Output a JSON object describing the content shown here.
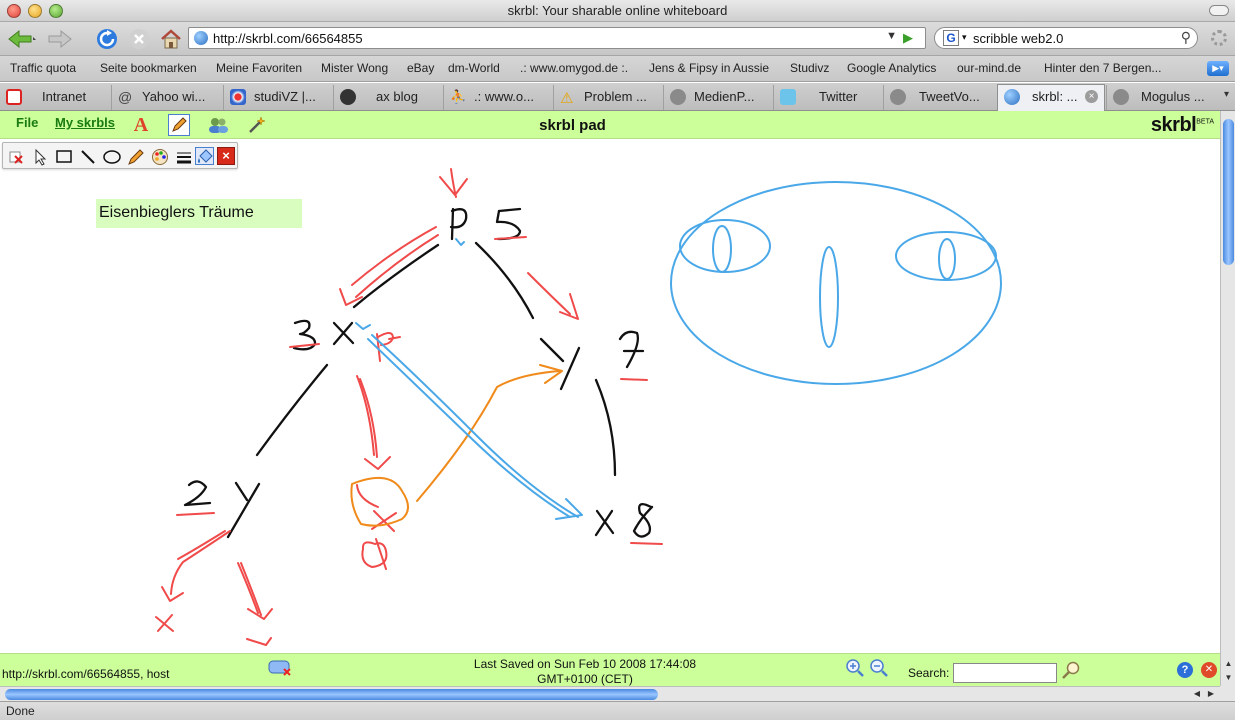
{
  "window": {
    "title": "skrbl: Your sharable online whiteboard"
  },
  "nav": {
    "url": "http://skrbl.com/66564855",
    "search_value": "scribble web2.0"
  },
  "bookmarks": [
    "Traffic quota",
    "Seite bookmarken",
    "Meine Favoriten",
    "Mister Wong",
    "eBay",
    "dm-World",
    ".: www.omygod.de :.",
    "Jens & Fipsy in Aussie",
    "Studivz",
    "Google Analytics",
    "our-mind.de",
    "Hinter den 7 Bergen..."
  ],
  "tabs": [
    {
      "label": "Intranet",
      "icon": "pdf-icon"
    },
    {
      "label": "Yahoo wi...",
      "icon": "at-icon"
    },
    {
      "label": "studiVZ |...",
      "icon": "studivz-icon"
    },
    {
      "label": "ax blog",
      "icon": "wordpress-icon"
    },
    {
      "label": ".: www.o...",
      "icon": "figure-icon"
    },
    {
      "label": "Problem ...",
      "icon": "warning-icon"
    },
    {
      "label": "MedienP...",
      "icon": "generic-page-icon"
    },
    {
      "label": "Twitter",
      "icon": "twitter-icon"
    },
    {
      "label": "TweetVo...",
      "icon": "generic-page-icon"
    },
    {
      "label": "skrbl: ...",
      "icon": "globe-icon",
      "active": true
    },
    {
      "label": "Mogulus ...",
      "icon": "generic-page-icon"
    }
  ],
  "app": {
    "file_label": "File",
    "my_skrbls_label": "My skrbls",
    "pad_title": "skrbl pad",
    "brand": "skrbl",
    "brand_tag": "BETA",
    "note_text": "Eisenbieglers Träume"
  },
  "drawtools": [
    "clear-icon",
    "select-arrow-icon",
    "rectangle-icon",
    "line-icon",
    "ellipse-icon",
    "pencil-icon",
    "palette-icon",
    "line-width-icon",
    "fill-bucket-icon",
    "close-icon"
  ],
  "status": {
    "pad_url": "http://skrbl.com/66564855, host",
    "saved_line1": "Last Saved on Sun Feb 10 2008 17:44:08",
    "saved_line2": "GMT+0100 (CET)",
    "search_label": "Search:",
    "help_glyph": "?",
    "browser_status": "Done"
  },
  "colors": {
    "app_green": "#ccff99",
    "note_green": "#d9fcbf",
    "ink_black": "#111111",
    "ink_red": "#f04a4a",
    "ink_blue": "#4aa8e8",
    "ink_orange": "#f08a1a",
    "link_green": "#1a7b12"
  }
}
